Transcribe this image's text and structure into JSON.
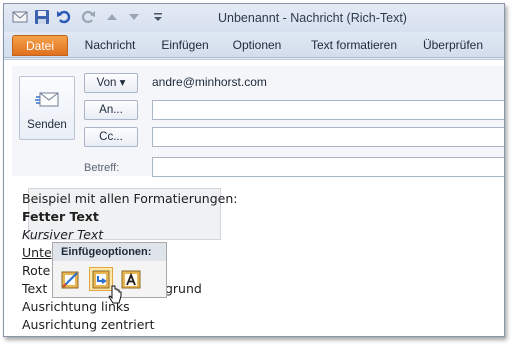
{
  "window": {
    "title": "Unbenannt  -  Nachricht (Rich-Text)"
  },
  "qat": {
    "icons": [
      "outlook-icon",
      "save-icon",
      "undo-icon",
      "redo-icon",
      "up-icon",
      "down-icon",
      "customize-icon"
    ]
  },
  "tabs": [
    {
      "label": "Datei"
    },
    {
      "label": "Nachricht"
    },
    {
      "label": "Einfügen"
    },
    {
      "label": "Optionen"
    },
    {
      "label": "Text formatieren"
    },
    {
      "label": "Überprüfen"
    }
  ],
  "header": {
    "send_label": "Senden",
    "from_button": "Von ▾",
    "from_address": "andre@minhorst.com",
    "to_button": "An...",
    "cc_button": "Cc...",
    "subject_label": "Betreff:"
  },
  "body": {
    "lines": [
      "Beispiel mit allen Formatierungen:",
      "Fetter Text",
      "Kursiver Text",
      "Unte",
      "Rote",
      "Text mit gelbem Hintergrund",
      "Ausrichtung links",
      "Ausrichtung zentriert"
    ]
  },
  "paste_popup": {
    "title": "Einfügeoptionen:",
    "options": [
      "keep-source-formatting-icon",
      "merge-formatting-icon",
      "keep-text-only-icon"
    ]
  },
  "colors": {
    "file_tab": "#e0701e",
    "highlight": "#fde8a9"
  }
}
